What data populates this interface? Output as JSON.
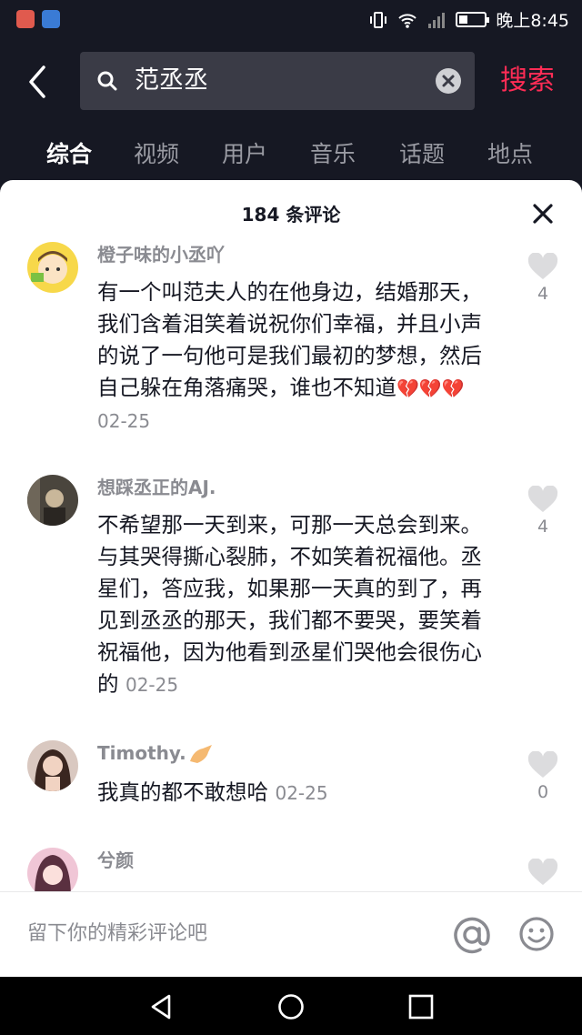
{
  "status_bar": {
    "time": "晚上8:45"
  },
  "search": {
    "query": "范丞丞",
    "submit_label": "搜索"
  },
  "tabs": [
    {
      "label": "综合",
      "active": true
    },
    {
      "label": "视频"
    },
    {
      "label": "用户"
    },
    {
      "label": "音乐"
    },
    {
      "label": "话题"
    },
    {
      "label": "地点"
    }
  ],
  "comments_panel": {
    "title": "184 条评论",
    "comments": [
      {
        "username": "橙子味的小丞吖",
        "text": "有一个叫范夫人的在他身边，结婚那天，我们含着泪笑着说祝你们幸福，并且小声的说了一句他可是我们最初的梦想，然后自己躲在角落痛哭，谁也不知道",
        "emoji": "💔💔💔",
        "time": "02-25",
        "likes": "4"
      },
      {
        "username": "想踩丞正的AJ.",
        "text": "不希望那一天到来，可那一天总会到来。与其哭得撕心裂肺，不如笑着祝福他。丞星们，答应我，如果那一天真的到了，再见到丞丞的那天，我们都不要哭，要笑着祝福他，因为他看到丞星们哭他会很伤心的",
        "time": "02-25",
        "likes": "4"
      },
      {
        "username": "Timothy.",
        "text": "我真的都不敢想哈",
        "time": "02-25",
        "likes": "0"
      },
      {
        "username": "兮颜"
      }
    ]
  },
  "input_bar": {
    "placeholder": "留下你的精彩评论吧"
  },
  "colors": {
    "background": "#161823",
    "accent": "#fe2c55",
    "secondary_text": "#8a8b91"
  }
}
